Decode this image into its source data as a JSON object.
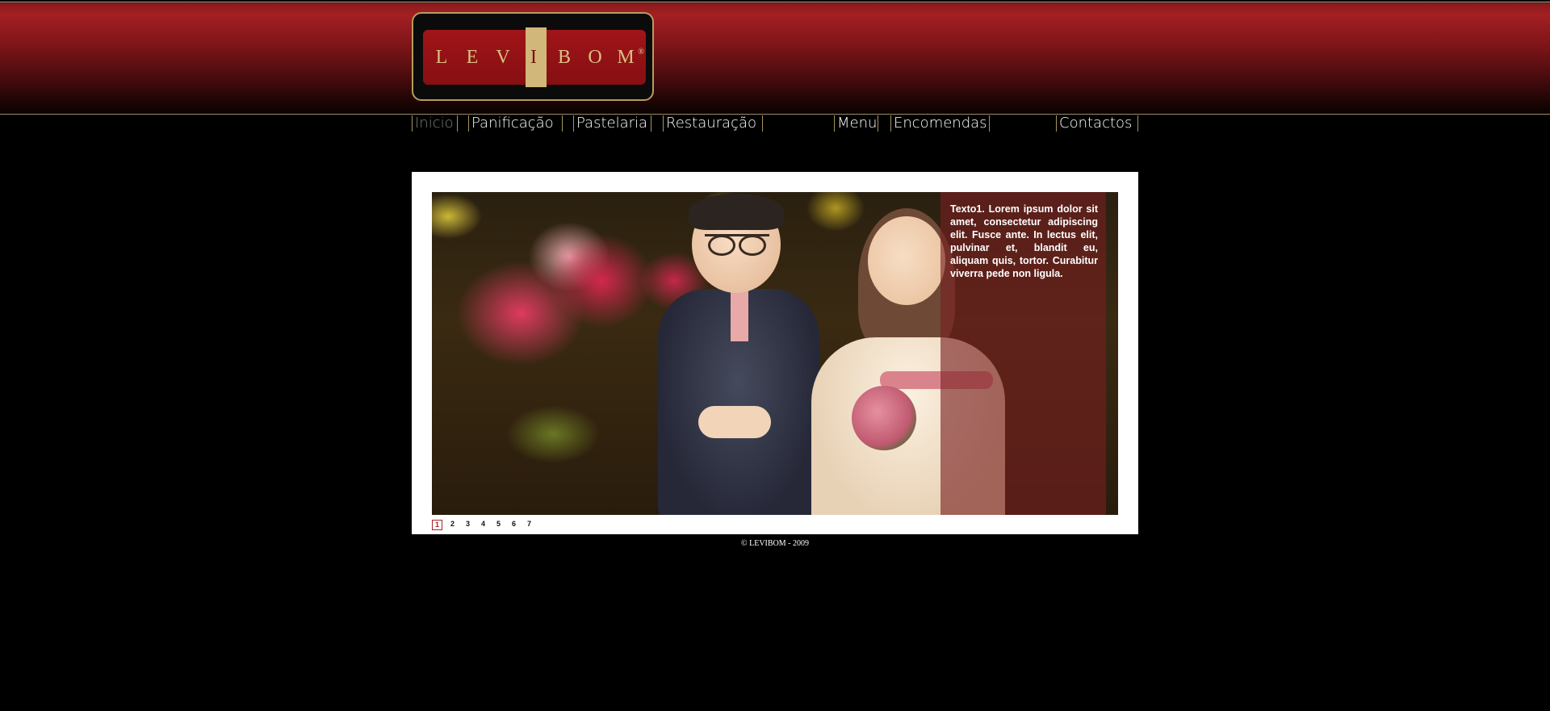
{
  "brand": {
    "letters": [
      "L",
      "E",
      "V",
      "I",
      "B",
      "O",
      "M"
    ],
    "highlight_index": 3,
    "registered_mark": "®",
    "colors": {
      "plate": "#a01418",
      "gold": "#d9c080",
      "highlight": "#d1b779"
    }
  },
  "nav": {
    "items": [
      {
        "label": "Inicio",
        "active": true
      },
      {
        "label": "Panificação",
        "active": false
      },
      {
        "label": "Pastelaria",
        "active": false
      },
      {
        "label": "Restauração",
        "active": false
      },
      {
        "label": "Menu",
        "active": false
      },
      {
        "label": "Encomendas",
        "active": false
      },
      {
        "label": "Contactos",
        "active": false
      }
    ]
  },
  "slider": {
    "caption": "Texto1. Lorem ipsum dolor sit amet, consectetur adipiscing elit. Fusce ante. In lectus elit, pulvinar et, blandit eu, aliquam quis, tortor. Curabitur viverra pede non ligula.",
    "pages": [
      "1",
      "2",
      "3",
      "4",
      "5",
      "6",
      "7"
    ],
    "current_page": "1"
  },
  "footer": {
    "text": "© LEVIBOM - 2009"
  }
}
